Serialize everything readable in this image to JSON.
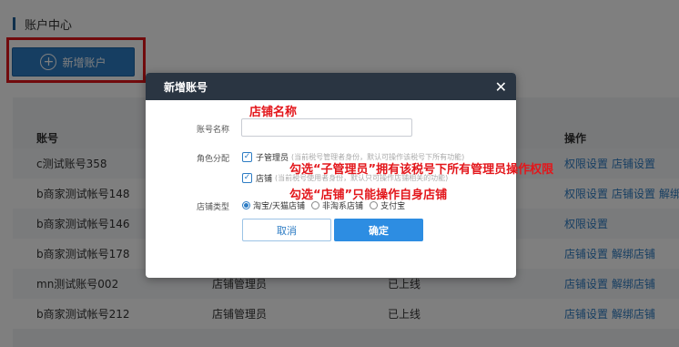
{
  "page": {
    "title": "账户中心",
    "add_button_label": "新增账户"
  },
  "table": {
    "headers": {
      "account": "账号",
      "operations": "操作"
    },
    "rows": [
      {
        "account": "c测试账号358",
        "role": "",
        "status": "",
        "ops": [
          "权限设置",
          "店铺设置"
        ]
      },
      {
        "account": "b商家测试帐号148",
        "role": "",
        "status": "",
        "ops": [
          "权限设置",
          "店铺设置",
          "解绑店"
        ]
      },
      {
        "account": "b商家测试帐号146",
        "role": "",
        "status": "",
        "ops": [
          "权限设置"
        ]
      },
      {
        "account": "b商家测试帐号178",
        "role": "",
        "status": "",
        "ops": [
          "店铺设置",
          "解绑店铺"
        ]
      },
      {
        "account": "mn测试账号002",
        "role": "店铺管理员",
        "status": "已上线",
        "ops": [
          "店铺设置",
          "解绑店铺"
        ]
      },
      {
        "account": "b商家测试帐号212",
        "role": "店铺管理员",
        "status": "已上线",
        "ops": [
          "店铺设置",
          "解绑店铺"
        ]
      }
    ]
  },
  "dialog": {
    "title": "新增账号",
    "close_glyph": "✕",
    "account_name_label": "账号名称",
    "account_name_value": "",
    "role_label": "角色分配",
    "role_options": [
      {
        "label": "子管理员",
        "checked": true,
        "hint": "(当前税号管理者身份，默认可操作该税号下所有功能)"
      },
      {
        "label": "店铺",
        "checked": true,
        "hint": "(当前税号使用者身份，默认只可操作店铺相关的功能)"
      }
    ],
    "shop_type_label": "店铺类型",
    "shop_types": [
      {
        "label": "淘宝/天猫店铺",
        "selected": true
      },
      {
        "label": "非淘系店铺",
        "selected": false
      },
      {
        "label": "支付宝",
        "selected": false
      }
    ],
    "cancel_label": "取消",
    "confirm_label": "确定"
  },
  "annotations": {
    "shop_name": "店铺名称",
    "sub_admin": "勾选“子管理员”拥有该税号下所有管理员操作权限",
    "shop": "勾选“店铺”只能操作自身店铺"
  },
  "colors": {
    "accent": "#2d7cc4",
    "dialog_header": "#2a3542",
    "annotation_red": "#e3161b"
  }
}
